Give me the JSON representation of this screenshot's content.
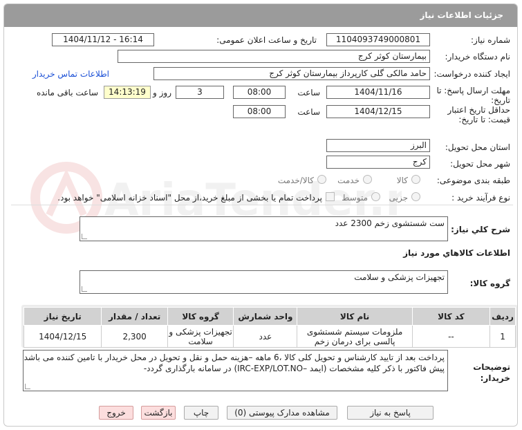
{
  "header": {
    "title": "جزئیات اطلاعات نیاز"
  },
  "fields": {
    "need_number_label": "شماره نیاز:",
    "need_number": "1104093749000801",
    "announce_label": "تاریخ و ساعت اعلان عمومی:",
    "announce_value": "1404/11/12 - 16:14",
    "buyer_org_label": "نام دستگاه خریدار:",
    "buyer_org": "بیمارستان کوثر کرج",
    "creator_label": "ایجاد کننده درخواست:",
    "creator": "حامد مالکی گلی کارپرداز بیمارستان کوثر کرج",
    "contact_link": "اطلاعات تماس خریدار",
    "reply_deadline_label": "مهلت ارسال پاسخ: تا تاریخ:",
    "reply_date": "1404/11/16",
    "time_label": "ساعت",
    "reply_time": "08:00",
    "days_value": "3",
    "days_label": "روز و",
    "remaining_time": "14:13:19",
    "remaining_label": "ساعت باقی مانده",
    "min_validity_label": "حداقل تاریخ اعتبار قیمت: تا تاریخ:",
    "validity_date": "1404/12/15",
    "validity_time": "08:00",
    "province_label": "استان محل تحویل:",
    "province": "البرز",
    "city_label": "شهر محل تحویل:",
    "city": "کرج",
    "category_label": "طبقه بندی موضوعی:",
    "category_options": [
      "کالا",
      "خدمت",
      "کالا/خدمت"
    ],
    "process_label": "نوع فرآیند خرید :",
    "process_options": [
      "جزیی",
      "متوسط"
    ],
    "payment_note": "پرداخت تمام یا بخشی از مبلغ خرید،از محل \"اسناد خزانه اسلامی\" خواهد بود."
  },
  "description": {
    "label": "شرح کلي نياز:",
    "value": "ست شستشوی زخم  2300 عدد"
  },
  "goods_info_title": "اطلاعات کالاهاي مورد نياز",
  "goods_group": {
    "label": "گروه کالا:",
    "value": "تجهیزات پزشکی و سلامت"
  },
  "table": {
    "headers": [
      "ردیف",
      "کد کالا",
      "نام کالا",
      "واحد شمارش",
      "گروه کالا",
      "تعداد / مقدار",
      "تاریخ نیاز"
    ],
    "rows": [
      [
        "1",
        "--",
        "ملزومات سیستم شستشوی پالسی برای درمان زخم",
        "عدد",
        "تجهیزات پزشکی و سلامت",
        "2,300",
        "1404/12/15"
      ]
    ]
  },
  "buyer_notes": {
    "label": "توضیحات خریدار:",
    "line1": "پرداخت بعد از تایید کارشناس و تحویل کلی کالا ،6 ماهه –هزینه حمل و نقل و تحویل در محل خریدار با تامین کننده می باشد-",
    "line2": "پیش فاکتور با ذکر کلیه مشخصات (ایمد –IRC-EXP/LOT.NO) در سامانه بارگذاری گردد-"
  },
  "buttons": {
    "reply": "پاسخ به نیاز",
    "attachments": "مشاهده مدارک پیوستی (0)",
    "print": "چاپ",
    "back": "بازگشت",
    "exit": "خروج"
  },
  "colors": {
    "titlebar": "#9b9b9b",
    "link": "#1a4fd6",
    "highlight": "#ffffcc"
  }
}
